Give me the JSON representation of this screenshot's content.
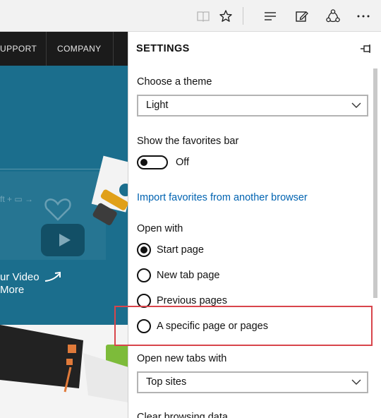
{
  "toolbar": {
    "icons": [
      "reading-view-icon",
      "favorite-star-icon",
      "hub-icon",
      "web-note-icon",
      "share-icon",
      "more-icon"
    ]
  },
  "webpage": {
    "nav": [
      "UPPORT",
      "COMPANY"
    ],
    "hero_video_title": "ur Video",
    "hero_more": "More",
    "hero_illustration_text": "ft + ▭ →"
  },
  "settings": {
    "title": "SETTINGS",
    "theme": {
      "label": "Choose a theme",
      "value": "Light"
    },
    "favorites_bar": {
      "label": "Show the favorites bar",
      "state": "Off",
      "on": false
    },
    "import_link": "Import favorites from another browser",
    "open_with": {
      "label": "Open with",
      "options": [
        {
          "label": "Start page",
          "selected": true
        },
        {
          "label": "New tab page",
          "selected": false
        },
        {
          "label": "Previous pages",
          "selected": false
        },
        {
          "label": "A specific page or pages",
          "selected": false
        }
      ]
    },
    "new_tabs": {
      "label": "Open new tabs with",
      "value": "Top sites"
    },
    "clear_browsing_data": "Clear browsing data"
  },
  "colors": {
    "link": "#0063b1",
    "highlight": "#d8454b",
    "hero_bg": "#1b6e8d",
    "site_nav_bg": "#1b1b1b"
  }
}
